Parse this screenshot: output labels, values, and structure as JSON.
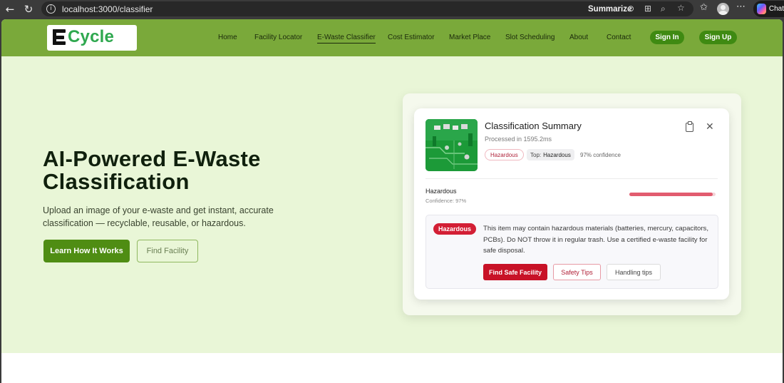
{
  "browser": {
    "url": "localhost:3000/classifier",
    "summarize_label": "Summarize",
    "copilot_label": "Chat"
  },
  "brand": {
    "name": "Cycle",
    "color": "#2fa84f"
  },
  "nav": {
    "items": [
      {
        "label": "Home"
      },
      {
        "label": "Facility Locator"
      },
      {
        "label": "E-Waste Classifier",
        "active": true
      },
      {
        "label": "Cost Estimator"
      },
      {
        "label": "Market Place"
      },
      {
        "label": "Slot Scheduling"
      },
      {
        "label": "About"
      },
      {
        "label": "Contact"
      }
    ],
    "sign_in": "Sign In",
    "sign_up": "Sign Up"
  },
  "hero": {
    "title": "AI-Powered E-Waste Classification",
    "subtitle": "Upload an image of your e-waste and get instant, accurate classification — recyclable, reusable, or hazardous.",
    "primary_button": "Learn How It Works",
    "secondary_button": "Find Facility"
  },
  "summary": {
    "title": "Classification Summary",
    "processed": "Processed in 1595.2ms",
    "tag_label": "Hazardous",
    "top_prefix": "Top:",
    "top_value": "Hazardous",
    "confidence_text": "97% confidence",
    "result_label": "Hazardous",
    "result_confidence": "Confidence: 97%",
    "confidence_value": 0.97,
    "warning_badge": "Hazardous",
    "warning_text": "This item may contain hazardous materials (batteries, mercury, capacitors, PCBs). Do NOT throw it in regular trash. Use a certified e-waste facility for safe disposal.",
    "actions": {
      "find_facility": "Find Safe Facility",
      "safety_tips": "Safety Tips",
      "handling_tips": "Handling tips"
    }
  },
  "colors": {
    "header": "#7aa93a",
    "hero_bg": "#e9f6d7",
    "primary": "#4f8d13",
    "danger": "#c81227"
  }
}
